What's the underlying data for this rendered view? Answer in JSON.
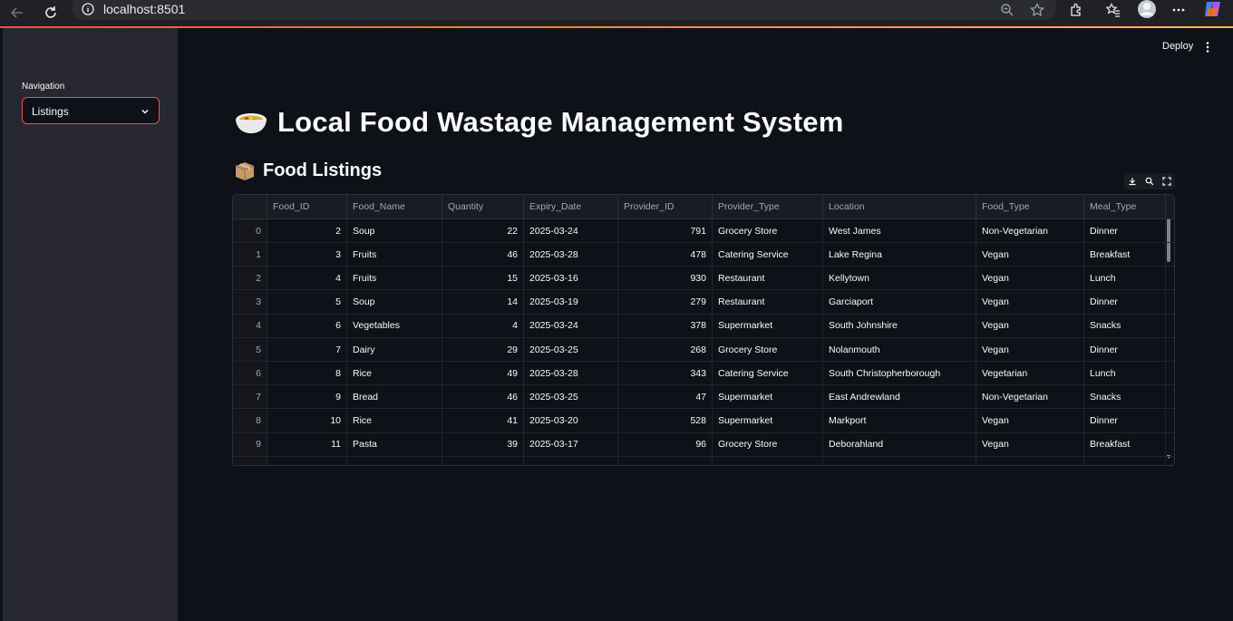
{
  "browser": {
    "url": "localhost:8501"
  },
  "sidebar": {
    "nav_label": "Navigation",
    "selected_page": "Listings"
  },
  "header": {
    "deploy_label": "Deploy"
  },
  "main": {
    "title": "Local Food Wastage Management System",
    "subtitle": "Food Listings"
  },
  "table": {
    "columns": [
      "",
      "Food_ID",
      "Food_Name",
      "Quantity",
      "Expiry_Date",
      "Provider_ID",
      "Provider_Type",
      "Location",
      "Food_Type",
      "Meal_Type"
    ],
    "rows": [
      [
        "0",
        "2",
        "Soup",
        "22",
        "2025-03-24",
        "791",
        "Grocery Store",
        "West James",
        "Non-Vegetarian",
        "Dinner"
      ],
      [
        "1",
        "3",
        "Fruits",
        "46",
        "2025-03-28",
        "478",
        "Catering Service",
        "Lake Regina",
        "Vegan",
        "Breakfast"
      ],
      [
        "2",
        "4",
        "Fruits",
        "15",
        "2025-03-16",
        "930",
        "Restaurant",
        "Kellytown",
        "Vegan",
        "Lunch"
      ],
      [
        "3",
        "5",
        "Soup",
        "14",
        "2025-03-19",
        "279",
        "Restaurant",
        "Garciaport",
        "Vegan",
        "Dinner"
      ],
      [
        "4",
        "6",
        "Vegetables",
        "4",
        "2025-03-24",
        "378",
        "Supermarket",
        "South Johnshire",
        "Vegan",
        "Snacks"
      ],
      [
        "5",
        "7",
        "Dairy",
        "29",
        "2025-03-25",
        "268",
        "Grocery Store",
        "Nolanmouth",
        "Vegan",
        "Dinner"
      ],
      [
        "6",
        "8",
        "Rice",
        "49",
        "2025-03-28",
        "343",
        "Catering Service",
        "South Christopherborough",
        "Vegetarian",
        "Lunch"
      ],
      [
        "7",
        "9",
        "Bread",
        "46",
        "2025-03-25",
        "47",
        "Supermarket",
        "East Andrewland",
        "Non-Vegetarian",
        "Snacks"
      ],
      [
        "8",
        "10",
        "Rice",
        "41",
        "2025-03-20",
        "528",
        "Supermarket",
        "Markport",
        "Vegan",
        "Dinner"
      ],
      [
        "9",
        "11",
        "Pasta",
        "39",
        "2025-03-17",
        "96",
        "Grocery Store",
        "Deborahland",
        "Vegan",
        "Breakfast"
      ]
    ]
  },
  "colors": {
    "accent": "#ff4b4b",
    "background": "#0e1117",
    "sidebar": "#262730"
  }
}
